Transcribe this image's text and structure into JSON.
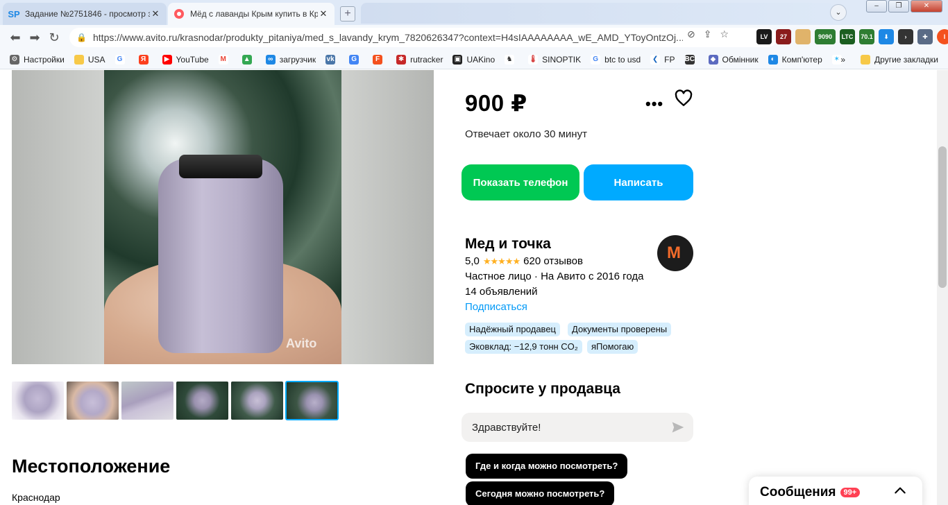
{
  "browser": {
    "tabs": [
      {
        "favicon": "SP",
        "title": "Задание №2751846 - просмотр з",
        "active": false
      },
      {
        "favicon": "avito-icon",
        "title": "Мёд с лаванды Крым купить в Кр",
        "active": true
      }
    ],
    "url": "https://www.avito.ru/krasnodar/produkty_pitaniya/med_s_lavandy_krym_7820626347?context=H4sIAAAAAAAA_wE_AMD_YToyOntzOj...",
    "extensions": [
      {
        "label": "LV",
        "color": "#1a1a1a"
      },
      {
        "label": "27",
        "color": "#8a1c1c"
      },
      {
        "label": "9090",
        "color": "#2e7d32"
      },
      {
        "label": "LTC",
        "color": "#1b5e20"
      },
      {
        "label": "70.1",
        "color": "#2e7d32"
      }
    ],
    "profile_initial": "I",
    "bookmarks": [
      {
        "label": "Настройки",
        "icon": "gear-icon",
        "color": "#666"
      },
      {
        "label": "USA",
        "icon": "folder-icon",
        "color": "#f7c948"
      },
      {
        "label": "",
        "icon": "google-icon",
        "color": "#4285f4"
      },
      {
        "label": "",
        "icon": "yandex-icon",
        "color": "#fc3f1d"
      },
      {
        "label": "YouTube",
        "icon": "youtube-icon",
        "color": "#ff0000"
      },
      {
        "label": "",
        "icon": "gmail-icon",
        "color": "#ea4335"
      },
      {
        "label": "",
        "icon": "drive-icon",
        "color": "#34a853"
      },
      {
        "label": "загрузчик",
        "icon": "loader-icon",
        "color": "#1e88e5"
      },
      {
        "label": "",
        "icon": "vk-icon",
        "color": "#4a76a8"
      },
      {
        "label": "",
        "icon": "translate-icon",
        "color": "#4285f4"
      },
      {
        "label": "",
        "icon": "f-icon",
        "color": "#f4511e"
      },
      {
        "label": "rutracker",
        "icon": "rutracker-icon",
        "color": "#c62828"
      },
      {
        "label": "UAKino",
        "icon": "uakino-icon",
        "color": "#222"
      },
      {
        "label": "",
        "icon": "chess-icon",
        "color": "#333"
      },
      {
        "label": "SINOPTIK",
        "icon": "sinoptik-icon",
        "color": "#d32f2f"
      },
      {
        "label": "btc to usd",
        "icon": "google-icon",
        "color": "#4285f4"
      },
      {
        "label": "FP",
        "icon": "fp-icon",
        "color": "#1565c0"
      },
      {
        "label": "",
        "icon": "bc-icon",
        "color": "#333"
      },
      {
        "label": "Обмінник",
        "icon": "exchange-icon",
        "color": "#5c6bc0"
      },
      {
        "label": "Комп'ютер",
        "icon": "computer-icon",
        "color": "#1e88e5"
      },
      {
        "label": "",
        "icon": "star-icon",
        "color": "#29b6f6"
      }
    ],
    "bookmarks_more": "»",
    "other_bookmarks": "Другие закладки"
  },
  "listing": {
    "price": "900 ₽",
    "reply_time": "Отвечает около 30 минут",
    "show_phone_label": "Показать телефон",
    "write_label": "Написать",
    "photo_watermark": "Avito",
    "thumbnail_count": 6,
    "selected_thumbnail": 6
  },
  "seller": {
    "name": "Мед и точка",
    "rating": "5,0",
    "stars": "★★★★★",
    "reviews": "620 отзывов",
    "type": "Частное лицо · На Авито с 2016 года",
    "ads": "14 объявлений",
    "subscribe": "Подписаться",
    "logo_letter": "М",
    "badges": [
      "Надёжный продавец",
      "Документы проверены",
      "Эковклад: −12,9 тонн CO₂",
      "яПомогаю"
    ]
  },
  "ask": {
    "title": "Спросите у продавца",
    "message": "Здравствуйте!",
    "quick_questions": [
      "Где и когда можно посмотреть?",
      "Сегодня можно посмотреть?"
    ]
  },
  "location": {
    "title": "Местоположение",
    "city": "Краснодар"
  },
  "messages": {
    "label": "Сообщения",
    "count": "99+"
  },
  "colors": {
    "accent_green": "#00c853",
    "accent_blue": "#00aaff",
    "link_blue": "#0099f7",
    "badge_bg": "#d6eefd",
    "unread_red": "#ff4053"
  }
}
